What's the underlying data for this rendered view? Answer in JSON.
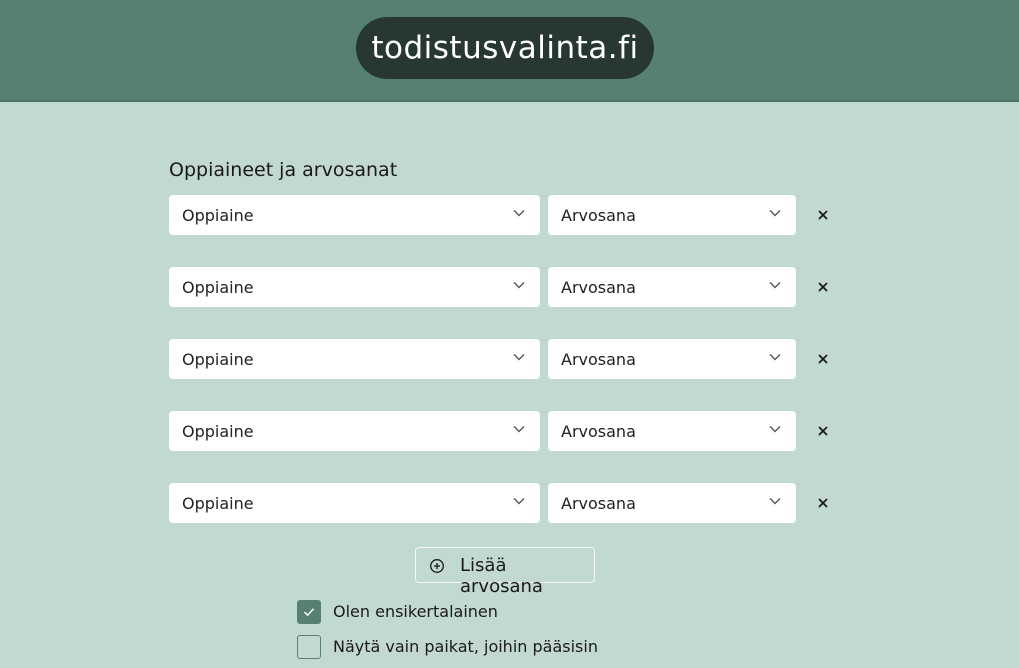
{
  "header": {
    "logo_text": "todistusvalinta.fi"
  },
  "section": {
    "title": "Oppiaineet ja arvosanat"
  },
  "rows": [
    {
      "subject_placeholder": "Oppiaine",
      "grade_placeholder": "Arvosana"
    },
    {
      "subject_placeholder": "Oppiaine",
      "grade_placeholder": "Arvosana"
    },
    {
      "subject_placeholder": "Oppiaine",
      "grade_placeholder": "Arvosana"
    },
    {
      "subject_placeholder": "Oppiaine",
      "grade_placeholder": "Arvosana"
    },
    {
      "subject_placeholder": "Oppiaine",
      "grade_placeholder": "Arvosana"
    }
  ],
  "add_button": {
    "label": "Lisää arvosana",
    "icon": "plus-circle-icon"
  },
  "options": [
    {
      "label": "Olen ensikertalainen",
      "checked": true
    },
    {
      "label": "Näytä vain paikat, joihin pääsisin",
      "checked": false
    }
  ],
  "colors": {
    "background": "#c2d9d3",
    "header": "#578071",
    "logo_pill": "#273832",
    "checkbox_checked": "#578071"
  }
}
